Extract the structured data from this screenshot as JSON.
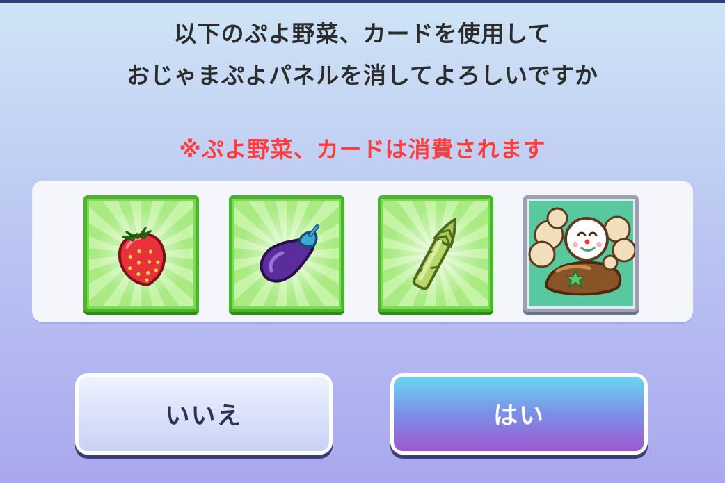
{
  "dialog": {
    "message_line1": "以下のぷよ野菜、カードを使用して",
    "message_line2": "おじゃまぷよパネルを消してよろしいですか",
    "warning": "※ぷよ野菜、カードは消費されます"
  },
  "items": [
    {
      "icon": "strawberry-icon",
      "kind": "vegetable"
    },
    {
      "icon": "eggplant-icon",
      "kind": "vegetable"
    },
    {
      "icon": "asparagus-icon",
      "kind": "vegetable"
    },
    {
      "icon": "character-card-icon",
      "kind": "card"
    }
  ],
  "buttons": {
    "no_label": "いいえ",
    "yes_label": "はい"
  },
  "colors": {
    "warning_text": "#ff3b3b",
    "vegetable_frame": "#47b825",
    "card_frame": "#9aa0b6",
    "yes_button_top": "#69d6f0",
    "yes_button_bottom": "#9d58d0"
  }
}
